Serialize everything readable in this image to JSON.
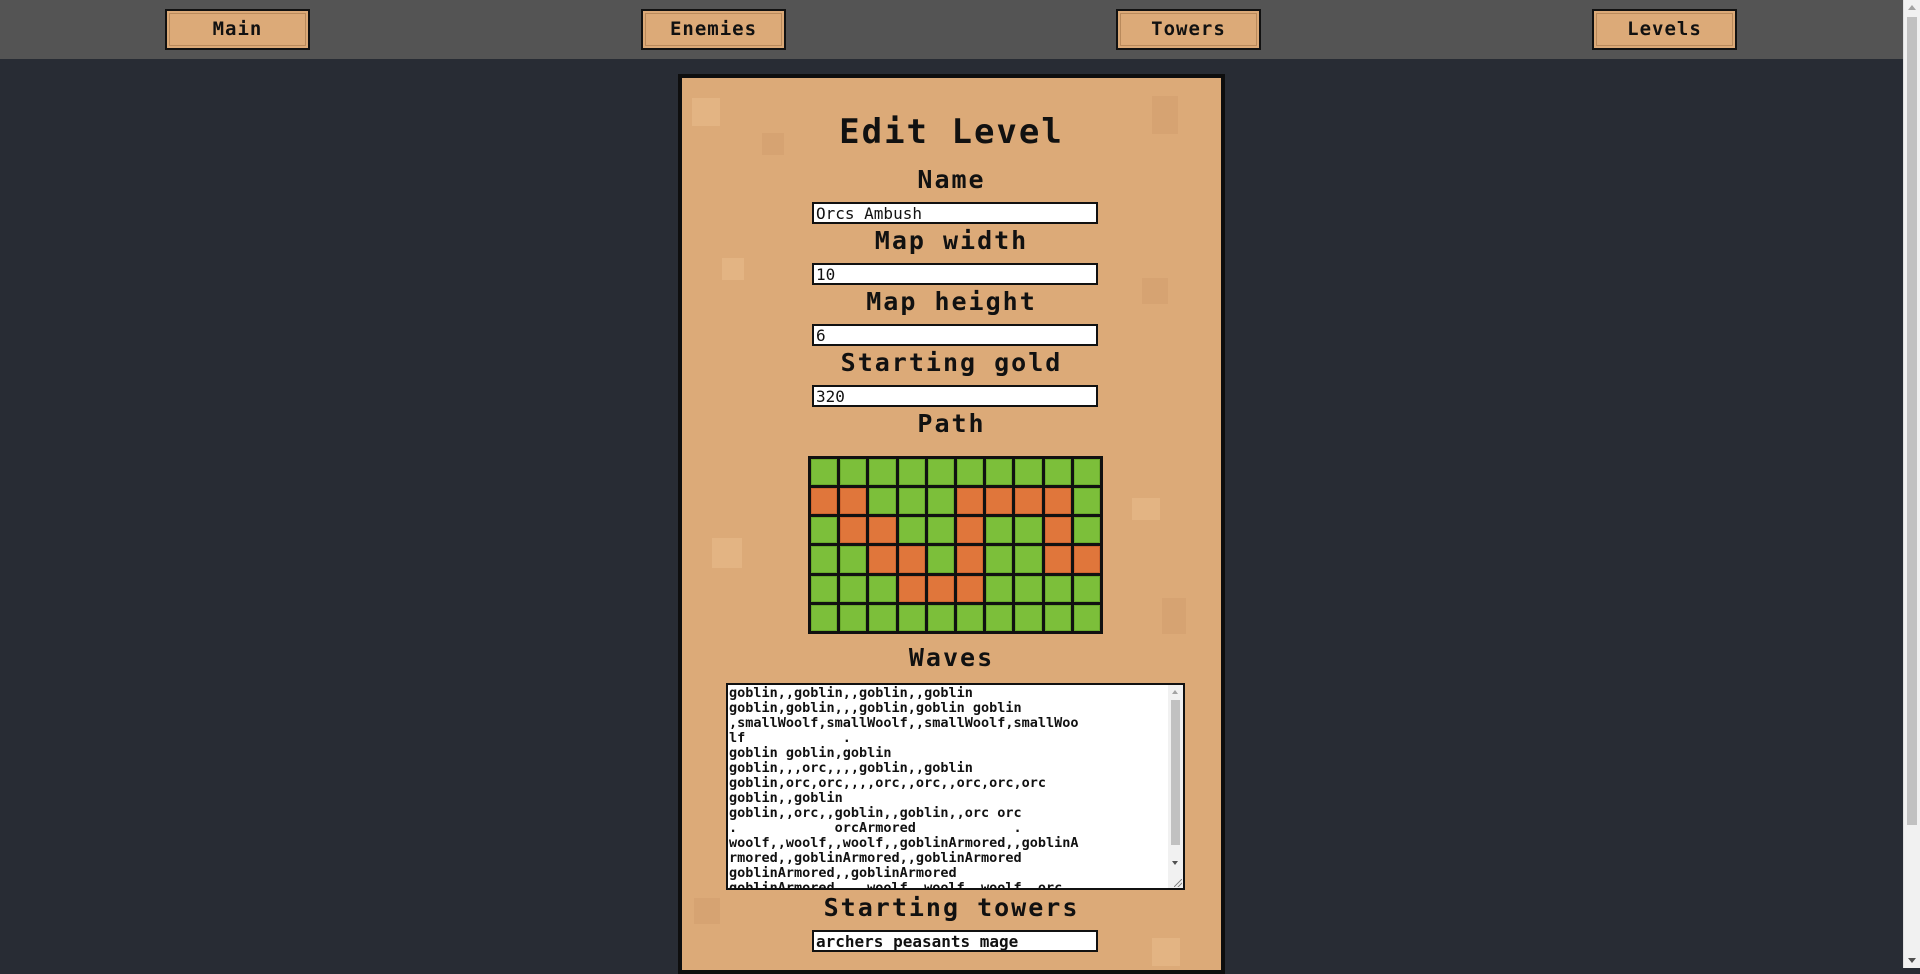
{
  "nav": {
    "main": "Main",
    "enemies": "Enemies",
    "towers": "Towers",
    "levels": "Levels"
  },
  "form": {
    "title": "Edit Level",
    "name_label": "Name",
    "name_value": "Orcs Ambush",
    "width_label": "Map width",
    "width_value": "10",
    "height_label": "Map height",
    "height_value": "6",
    "gold_label": "Starting gold",
    "gold_value": "320",
    "path_label": "Path",
    "waves_label": "Waves",
    "waves_lines": [
      "goblin,,goblin,,goblin,,goblin",
      "goblin,goblin,,,goblin,goblin goblin",
      ",smallWoolf,smallWoolf,,smallWoolf,smallWoo",
      "lf            .",
      "goblin goblin,goblin",
      "goblin,,,orc,,,,goblin,,goblin",
      "goblin,orc,orc,,,,orc,,orc,,orc,orc,orc",
      "goblin,,goblin",
      "goblin,,orc,,goblin,,goblin,,orc orc",
      ".            orcArmored            .",
      "woolf,,woolf,,woolf,,goblinArmored,,goblinA",
      "rmored,,goblinArmored,,goblinArmored",
      "goblinArmored,,goblinArmored",
      "goblinArmored,,,,woolf,,woolf,,woolf,,orc"
    ],
    "towers_label": "Starting towers",
    "towers_value": "archers peasants mage"
  },
  "path_grid": {
    "columns": 10,
    "rows": 6,
    "cells": [
      [
        0,
        0,
        0,
        0,
        0,
        0,
        0,
        0,
        0,
        0
      ],
      [
        1,
        1,
        0,
        0,
        0,
        1,
        1,
        1,
        1,
        0
      ],
      [
        0,
        1,
        1,
        0,
        0,
        1,
        0,
        0,
        1,
        0
      ],
      [
        0,
        0,
        1,
        1,
        0,
        1,
        0,
        0,
        1,
        1
      ],
      [
        0,
        0,
        0,
        1,
        1,
        1,
        0,
        0,
        0,
        0
      ],
      [
        0,
        0,
        0,
        0,
        0,
        0,
        0,
        0,
        0,
        0
      ]
    ],
    "colors": {
      "grass": "#7cbf3a",
      "path": "#e0763b"
    }
  },
  "colors": {
    "background": "#282c34",
    "topbar": "#545454",
    "panel": "#dcaa78",
    "button": "#dcaa78"
  }
}
